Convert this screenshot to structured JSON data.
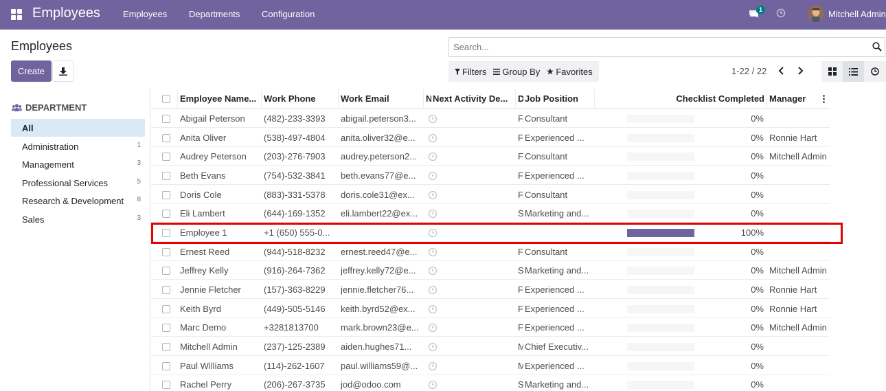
{
  "navbar": {
    "app_title": "Employees",
    "menu": [
      "Employees",
      "Departments",
      "Configuration"
    ],
    "chat_badge": "1",
    "user_name": "Mitchell Admin"
  },
  "control_panel": {
    "page_title": "Employees",
    "create_label": "Create",
    "search_placeholder": "Search...",
    "filters_label": "Filters",
    "groupby_label": "Group By",
    "favorites_label": "Favorites",
    "pager": "1-22 / 22"
  },
  "sidebar": {
    "header": "DEPARTMENT",
    "items": [
      {
        "label": "All",
        "count": "",
        "active": true
      },
      {
        "label": "Administration",
        "count": "1"
      },
      {
        "label": "Management",
        "count": "3"
      },
      {
        "label": "Professional Services",
        "count": "5"
      },
      {
        "label": "Research & Development",
        "count": "8"
      },
      {
        "label": "Sales",
        "count": "3"
      }
    ]
  },
  "table": {
    "columns": [
      "Employee Name...",
      "Work Phone",
      "Work Email",
      "N",
      "Next Activity De...",
      "D",
      "Job Position",
      "Checklist Completed",
      "Manager"
    ],
    "rows": [
      {
        "name": "Abigail Peterson",
        "phone": "(482)-233-3393",
        "email": "abigail.peterson3...",
        "d": "F",
        "job": "Consultant",
        "checklist": 0,
        "pct": "0%",
        "manager": ""
      },
      {
        "name": "Anita Oliver",
        "phone": "(538)-497-4804",
        "email": "anita.oliver32@e...",
        "d": "F",
        "job": "Experienced ...",
        "checklist": 0,
        "pct": "0%",
        "manager": "Ronnie Hart"
      },
      {
        "name": "Audrey Peterson",
        "phone": "(203)-276-7903",
        "email": "audrey.peterson2...",
        "d": "F",
        "job": "Consultant",
        "checklist": 0,
        "pct": "0%",
        "manager": "Mitchell Admin"
      },
      {
        "name": "Beth Evans",
        "phone": "(754)-532-3841",
        "email": "beth.evans77@e...",
        "d": "F",
        "job": "Experienced ...",
        "checklist": 0,
        "pct": "0%",
        "manager": ""
      },
      {
        "name": "Doris Cole",
        "phone": "(883)-331-5378",
        "email": "doris.cole31@ex...",
        "d": "F",
        "job": "Consultant",
        "checklist": 0,
        "pct": "0%",
        "manager": ""
      },
      {
        "name": "Eli Lambert",
        "phone": "(644)-169-1352",
        "email": "eli.lambert22@ex...",
        "d": "S",
        "job": "Marketing and...",
        "checklist": 0,
        "pct": "0%",
        "manager": ""
      },
      {
        "name": "Employee 1",
        "phone": "+1 (650) 555-0...",
        "email": "",
        "d": "",
        "job": "",
        "checklist": 1,
        "pct": "100%",
        "manager": ""
      },
      {
        "name": "Ernest Reed",
        "phone": "(944)-518-8232",
        "email": "ernest.reed47@e...",
        "d": "F",
        "job": "Consultant",
        "checklist": 0,
        "pct": "0%",
        "manager": ""
      },
      {
        "name": "Jeffrey Kelly",
        "phone": "(916)-264-7362",
        "email": "jeffrey.kelly72@e...",
        "d": "S",
        "job": "Marketing and...",
        "checklist": 0,
        "pct": "0%",
        "manager": "Mitchell Admin"
      },
      {
        "name": "Jennie Fletcher",
        "phone": "(157)-363-8229",
        "email": "jennie.fletcher76...",
        "d": "F",
        "job": "Experienced ...",
        "checklist": 0,
        "pct": "0%",
        "manager": "Ronnie Hart"
      },
      {
        "name": "Keith Byrd",
        "phone": "(449)-505-5146",
        "email": "keith.byrd52@ex...",
        "d": "F",
        "job": "Experienced ...",
        "checklist": 0,
        "pct": "0%",
        "manager": "Ronnie Hart"
      },
      {
        "name": "Marc Demo",
        "phone": "+3281813700",
        "email": "mark.brown23@e...",
        "d": "F",
        "job": "Experienced ...",
        "checklist": 0,
        "pct": "0%",
        "manager": "Mitchell Admin"
      },
      {
        "name": "Mitchell Admin",
        "phone": "(237)-125-2389",
        "email": "aiden.hughes71...",
        "d": "M",
        "job": "Chief Executiv...",
        "checklist": 0,
        "pct": "0%",
        "manager": ""
      },
      {
        "name": "Paul Williams",
        "phone": "(114)-262-1607",
        "email": "paul.williams59@...",
        "d": "M",
        "job": "Experienced ...",
        "checklist": 0,
        "pct": "0%",
        "manager": ""
      },
      {
        "name": "Rachel Perry",
        "phone": "(206)-267-3735",
        "email": "jod@odoo.com",
        "d": "S",
        "job": "Marketing and...",
        "checklist": 0,
        "pct": "0%",
        "manager": ""
      }
    ]
  },
  "colors": {
    "brand": "#71639e",
    "highlight": "#e60000",
    "badge": "#017e84"
  }
}
